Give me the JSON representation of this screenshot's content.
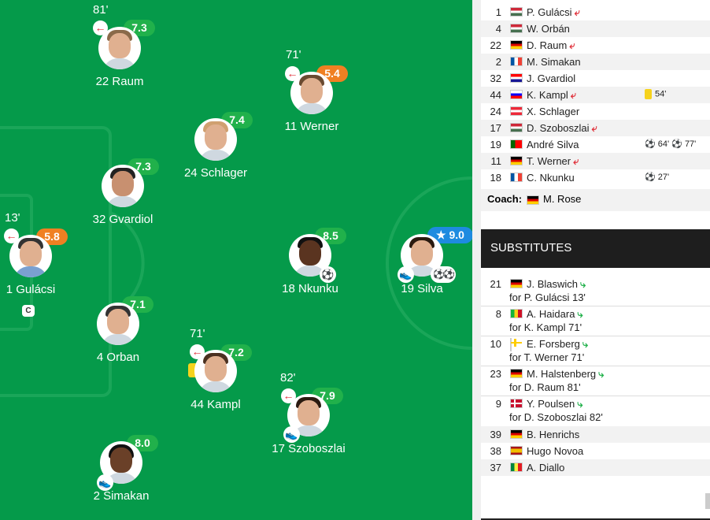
{
  "pitch": {
    "players": [
      {
        "id": "gulacsi",
        "number": "1",
        "name": "Gulácsi",
        "rating": "5.8",
        "rating_color": "orange",
        "sub_minute": "13'",
        "captain": "C"
      },
      {
        "id": "raum",
        "number": "22",
        "name": "Raum",
        "rating": "7.3",
        "rating_color": "green",
        "sub_minute": "81'"
      },
      {
        "id": "gvardiol",
        "number": "32",
        "name": "Gvardiol",
        "rating": "7.3",
        "rating_color": "green"
      },
      {
        "id": "orban",
        "number": "4",
        "name": "Orban",
        "rating": "7.1",
        "rating_color": "green"
      },
      {
        "id": "simakan",
        "number": "2",
        "name": "Simakan",
        "rating": "8.0",
        "rating_color": "green",
        "badge": "boot"
      },
      {
        "id": "schlager",
        "number": "24",
        "name": "Schlager",
        "rating": "7.4",
        "rating_color": "green"
      },
      {
        "id": "kampl",
        "number": "44",
        "name": "Kampl",
        "rating": "7.2",
        "rating_color": "green",
        "sub_minute": "71'",
        "card": "yellow"
      },
      {
        "id": "werner",
        "number": "11",
        "name": "Werner",
        "rating": "5.4",
        "rating_color": "orange",
        "sub_minute": "71'"
      },
      {
        "id": "nkunku",
        "number": "18",
        "name": "Nkunku",
        "rating": "8.5",
        "rating_color": "green",
        "badge": "ball"
      },
      {
        "id": "szoboszlai",
        "number": "17",
        "name": "Szoboszlai",
        "rating": "7.9",
        "rating_color": "green",
        "sub_minute": "82'",
        "badge": "boot"
      },
      {
        "id": "silva",
        "number": "19",
        "name": "Silva",
        "rating": "9.0",
        "rating_color": "blue",
        "star": "★",
        "badge": "boot",
        "badge2": "2 balls"
      }
    ]
  },
  "lineup": [
    {
      "num": "1",
      "flag": "hu",
      "name": "P. Gulácsi",
      "subbed_off": true
    },
    {
      "num": "4",
      "flag": "hu",
      "name": "W. Orbán"
    },
    {
      "num": "22",
      "flag": "de",
      "name": "D. Raum",
      "subbed_off": true
    },
    {
      "num": "2",
      "flag": "fr",
      "name": "M. Simakan"
    },
    {
      "num": "32",
      "flag": "hr",
      "name": "J. Gvardiol"
    },
    {
      "num": "44",
      "flag": "si",
      "name": "K. Kampl",
      "subbed_off": true,
      "event": "54'",
      "event_type": "yellow"
    },
    {
      "num": "24",
      "flag": "at",
      "name": "X. Schlager"
    },
    {
      "num": "17",
      "flag": "hu",
      "name": "D. Szoboszlai",
      "subbed_off": true
    },
    {
      "num": "19",
      "flag": "pt",
      "name": "André Silva",
      "event": "64'",
      "event2": "77'",
      "event_type": "goal2"
    },
    {
      "num": "11",
      "flag": "de",
      "name": "T. Werner",
      "subbed_off": true
    },
    {
      "num": "18",
      "flag": "fr",
      "name": "C. Nkunku",
      "event": "27'",
      "event_type": "goal"
    }
  ],
  "coach": {
    "label": "Coach:",
    "flag": "de",
    "name": "M. Rose"
  },
  "substitutes_title": "SUBSTITUTES",
  "substitutes": [
    {
      "num": "21",
      "flag": "de",
      "name": "J. Blaswich",
      "for": "for P. Gulácsi 13'"
    },
    {
      "num": "8",
      "flag": "ml",
      "name": "A. Haidara",
      "for": "for K. Kampl 71'"
    },
    {
      "num": "10",
      "flag": "se",
      "name": "E. Forsberg",
      "for": "for T. Werner 71'"
    },
    {
      "num": "23",
      "flag": "de",
      "name": "M. Halstenberg",
      "for": "for D. Raum 81'"
    },
    {
      "num": "9",
      "flag": "dk",
      "name": "Y. Poulsen",
      "for": "for D. Szoboszlai 82'"
    }
  ],
  "bench": [
    {
      "num": "39",
      "flag": "de",
      "name": "B. Henrichs"
    },
    {
      "num": "38",
      "flag": "es",
      "name": "Hugo Novoa"
    },
    {
      "num": "37",
      "flag": "sn",
      "name": "A. Diallo"
    }
  ]
}
